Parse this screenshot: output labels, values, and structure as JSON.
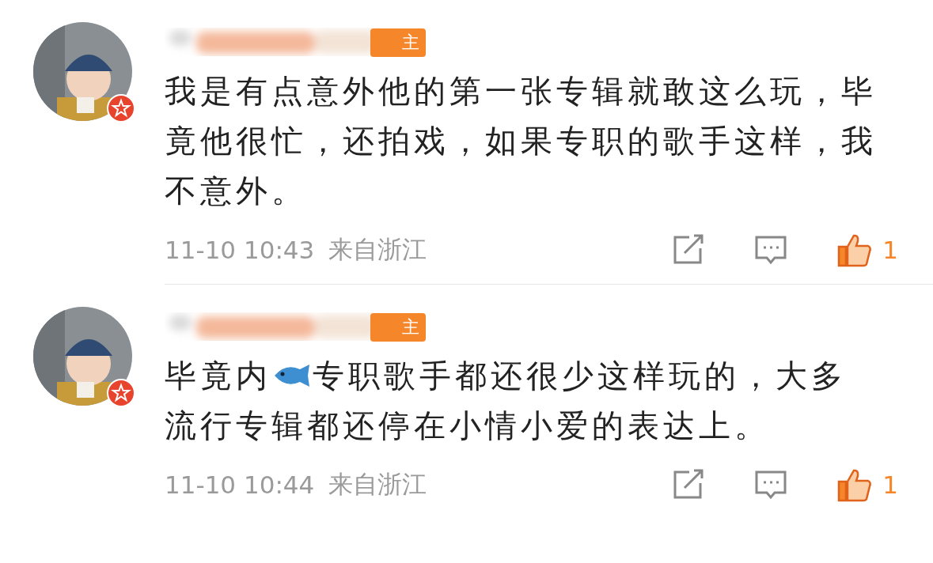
{
  "comments": [
    {
      "badge": "主",
      "segments": [
        {
          "kind": "text",
          "text": "我是有点意外他的第一张专辑就敢这么玩，毕竟他很忙，还拍戏，如果专职的歌手这样，我不意外。"
        }
      ],
      "time": "11-10 10:43",
      "location": "来自浙江",
      "likes": "1",
      "liked": true
    },
    {
      "badge": "主",
      "segments": [
        {
          "kind": "text",
          "text": "毕竟内"
        },
        {
          "kind": "fish"
        },
        {
          "kind": "text",
          "text": "专职歌手都还很少这样玩的，大多"
        },
        {
          "kind": "text",
          "text": "流行专辑都还停在小情小爱的表达上。"
        }
      ],
      "time": "11-10 10:44",
      "location": "来自浙江",
      "likes": "1",
      "liked": true
    }
  ]
}
